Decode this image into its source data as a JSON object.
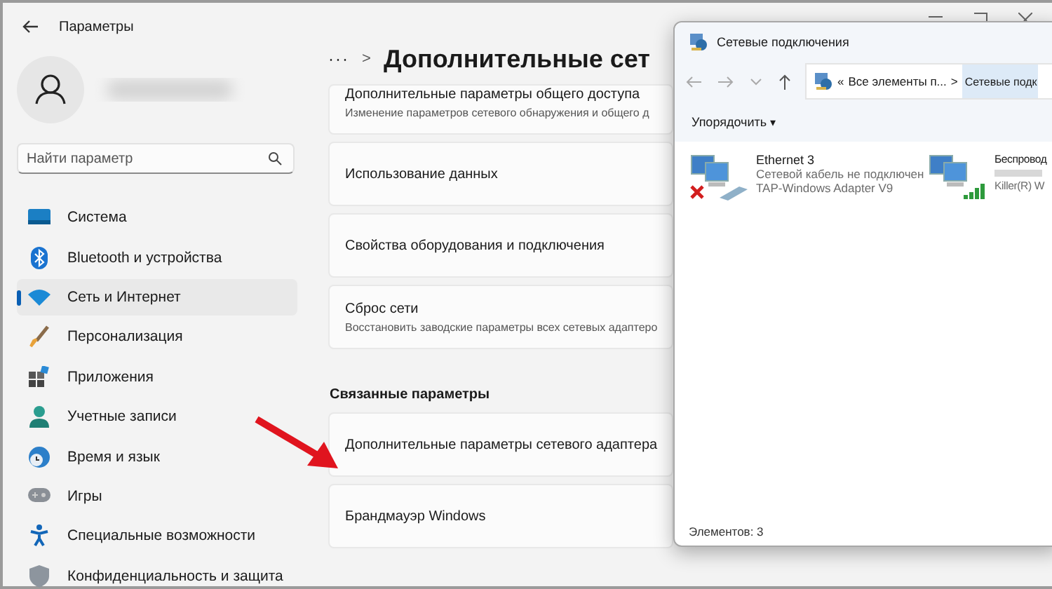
{
  "settings_window": {
    "title": "Параметры",
    "search": {
      "placeholder": "Найти параметр"
    },
    "sidebar": {
      "items": [
        {
          "label": "Система",
          "selected": false
        },
        {
          "label": "Bluetooth и устройства",
          "selected": false
        },
        {
          "label": "Сеть и Интернет",
          "selected": true
        },
        {
          "label": "Персонализация",
          "selected": false
        },
        {
          "label": "Приложения",
          "selected": false
        },
        {
          "label": "Учетные записи",
          "selected": false
        },
        {
          "label": "Время и язык",
          "selected": false
        },
        {
          "label": "Игры",
          "selected": false
        },
        {
          "label": "Специальные возможности",
          "selected": false
        },
        {
          "label": "Конфиденциальность и защита",
          "selected": false
        }
      ]
    },
    "breadcrumb": {
      "more": "···",
      "separator": ">",
      "title": "Дополнительные сет"
    },
    "cards": [
      {
        "title": "Дополнительные параметры общего доступа",
        "description": "Изменение параметров сетевого обнаружения и общего д"
      },
      {
        "title": "Использование данных"
      },
      {
        "title": "Свойства оборудования и подключения"
      },
      {
        "title": "Сброс сети",
        "description": "Восстановить заводские параметры всех сетевых адаптеро"
      }
    ],
    "related": {
      "heading": "Связанные параметры",
      "cards": [
        {
          "title": "Дополнительные параметры сетевого адаптера"
        },
        {
          "title": "Брандмауэр Windows"
        }
      ]
    }
  },
  "explorer_window": {
    "title": "Сетевые подключения",
    "address": {
      "overflow": "«",
      "parent": "Все элементы п...",
      "separator": ">",
      "current": "Сетевые подк"
    },
    "toolbar": {
      "organize": "Упорядочить",
      "caret": "▾"
    },
    "items": [
      {
        "kind": "ethernet",
        "name": "Ethernet 3",
        "status": "Сетевой кабель не подключен",
        "adapter": "TAP-Windows Adapter V9",
        "disconnected": true
      },
      {
        "kind": "wireless",
        "name": "Беспровод",
        "adapter": "Killer(R) W",
        "disconnected": false
      }
    ],
    "status_bar": "Элементов: 3"
  }
}
